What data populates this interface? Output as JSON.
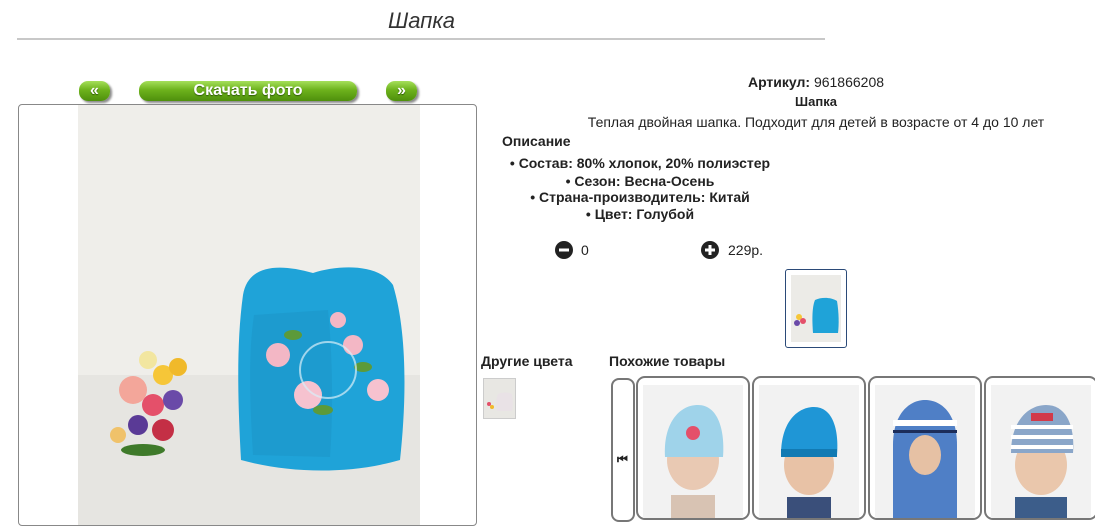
{
  "page": {
    "title": "Шапка"
  },
  "photo_nav": {
    "prev": "«",
    "download": "Скачать фото",
    "next": "»"
  },
  "product": {
    "sku_label": "Артикул:",
    "sku_value": "961866208",
    "name": "Шапка",
    "description": "Теплая двойная шапка. Подходит для детей в возрасте от 4 до 10 лет",
    "description_title": "Описание",
    "features": [
      "Состав: 80% хлопок, 20% полиэстер",
      "Сезон: Весна-Осень",
      "Страна-производитель: Китай",
      "Цвет: Голубой"
    ],
    "quantity": "0",
    "price": "229р."
  },
  "sections": {
    "other_colors": "Другие цвета",
    "similar_products": "Похожие товары"
  },
  "carousel": {
    "prev_glyph": "⏮"
  },
  "colors": {
    "accent_green": "#6db21c",
    "hat_blue": "#1fa3d8",
    "thumb_border": "#2b4a78"
  }
}
